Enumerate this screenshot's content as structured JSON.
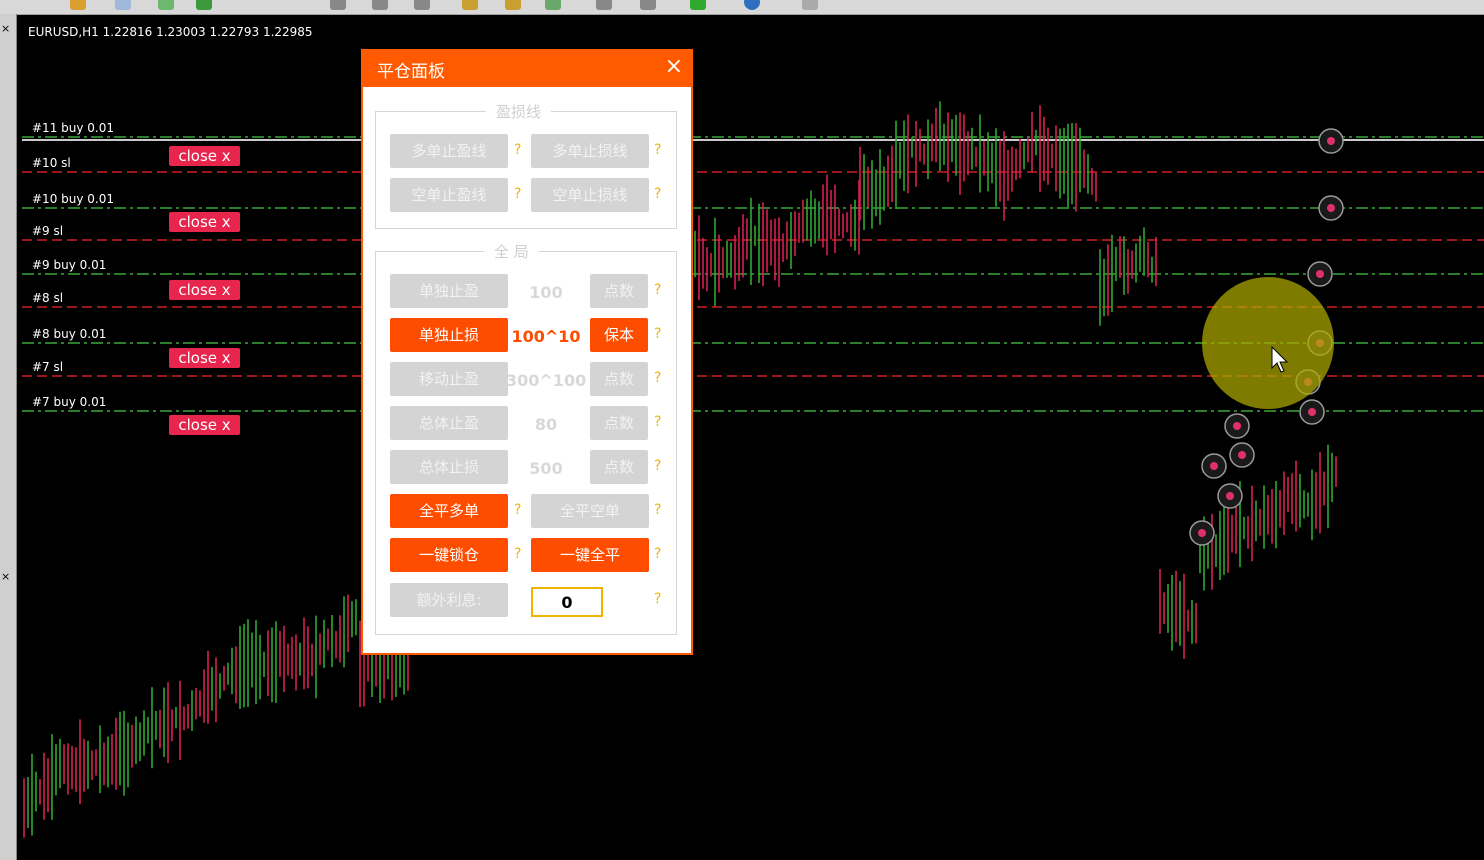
{
  "chart": {
    "title": "EURUSD,H1  1.22816 1.23003 1.22793 1.22985",
    "colors": {
      "bull": "#2ea82e",
      "bear": "#d62050",
      "sl_line": "#d02020",
      "buy_line": "#3aa83a"
    }
  },
  "order_lines": [
    {
      "label": "#11 buy 0.01",
      "type": "buy"
    },
    {
      "label": "#10 sl",
      "type": "sl",
      "close_label": "close x"
    },
    {
      "label": "#10 buy 0.01",
      "type": "buy"
    },
    {
      "label": "#9 sl",
      "type": "sl",
      "close_label": "close x"
    },
    {
      "label": "#9 buy 0.01",
      "type": "buy"
    },
    {
      "label": "#8 sl",
      "type": "sl",
      "close_label": "close x"
    },
    {
      "label": "#8 buy 0.01",
      "type": "buy"
    },
    {
      "label": "#7 sl",
      "type": "sl",
      "close_label": "close x"
    },
    {
      "label": "#7 buy 0.01",
      "type": "buy"
    }
  ],
  "close_buttons": [
    "close x",
    "close x",
    "close x",
    "close x"
  ],
  "panel": {
    "title": "平仓面板",
    "close_icon": "×",
    "section1_title": "盈损线",
    "section2_title": "全 局",
    "buttons": {
      "long_tp": "多单止盈线",
      "long_sl": "多单止损线",
      "short_tp": "空单止盈线",
      "short_sl": "空单止损线",
      "single_tp": "单独止盈",
      "single_sl": "单独止损",
      "trailing": "移动止盈",
      "total_tp": "总体止盈",
      "total_sl": "总体止损",
      "close_all_long": "全平多单",
      "close_all_short": "全平空单",
      "lock": "一键锁仓",
      "close_all": "一键全平",
      "extra_interest": "额外利息:"
    },
    "values": {
      "single_tp": "100",
      "single_sl": "100^10",
      "trailing": "300^100",
      "total_tp": "80",
      "total_sl": "500",
      "extra_interest": "0"
    },
    "unit_buttons": {
      "single_tp": "点数",
      "single_sl": "保本",
      "trailing": "点数",
      "total_tp": "点数",
      "total_sl": "点数"
    },
    "help": "?"
  }
}
